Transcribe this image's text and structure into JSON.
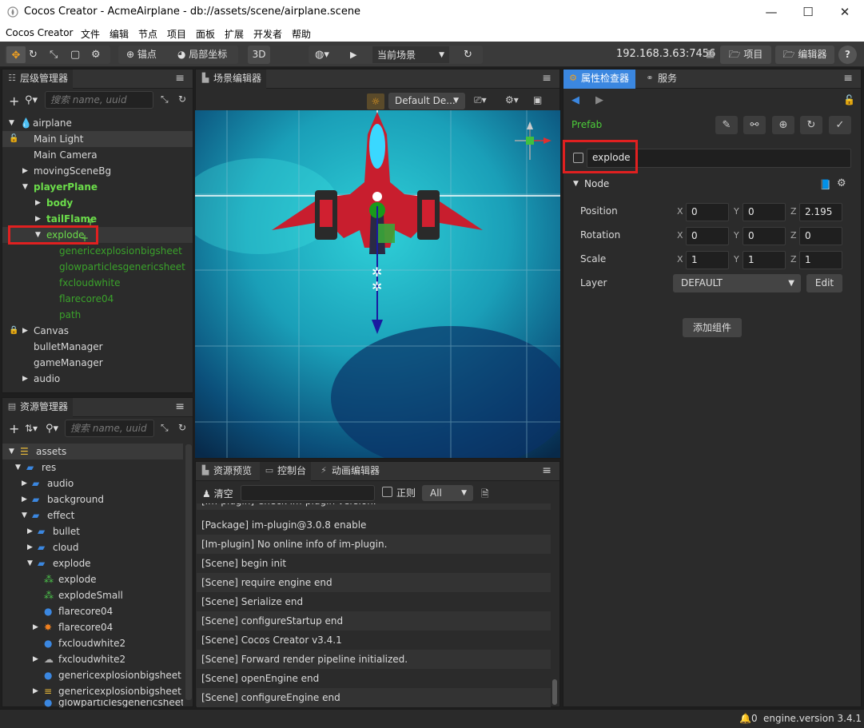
{
  "window": {
    "title": "Cocos Creator - AcmeAirplane - db://assets/scene/airplane.scene"
  },
  "menu": [
    "Cocos Creator",
    "文件",
    "编辑",
    "节点",
    "项目",
    "面板",
    "扩展",
    "开发者",
    "帮助"
  ],
  "toolbar": {
    "anchor_label": "锚点",
    "local_label": "局部坐标",
    "mode_3d": "3D",
    "scene_select": "当前场景",
    "ip": "192.168.3.63:7456",
    "project_btn": "项目",
    "editor_btn": "编辑器",
    "help": "?"
  },
  "hierarchy": {
    "tab": "层级管理器",
    "search_placeholder": "搜索 name, uuid",
    "items": [
      {
        "label": "airplane"
      },
      {
        "label": "Main Light"
      },
      {
        "label": "Main Camera"
      },
      {
        "label": "movingSceneBg"
      },
      {
        "label": "playerPlane"
      },
      {
        "label": "body"
      },
      {
        "label": "tailFlame"
      },
      {
        "label": "explode"
      },
      {
        "label": "genericexplosionbigsheet"
      },
      {
        "label": "glowparticlesgenericsheet"
      },
      {
        "label": "fxcloudwhite"
      },
      {
        "label": "flarecore04"
      },
      {
        "label": "path"
      },
      {
        "label": "Canvas"
      },
      {
        "label": "bulletManager"
      },
      {
        "label": "gameManager"
      },
      {
        "label": "audio"
      }
    ]
  },
  "assets": {
    "tab": "资源管理器",
    "search_placeholder": "搜索 name, uuid",
    "items": [
      {
        "label": "assets"
      },
      {
        "label": "res"
      },
      {
        "label": "audio"
      },
      {
        "label": "background"
      },
      {
        "label": "effect"
      },
      {
        "label": "bullet"
      },
      {
        "label": "cloud"
      },
      {
        "label": "explode"
      },
      {
        "label": "explode"
      },
      {
        "label": "explodeSmall"
      },
      {
        "label": "flarecore04"
      },
      {
        "label": "flarecore04"
      },
      {
        "label": "fxcloudwhite2"
      },
      {
        "label": "fxcloudwhite2"
      },
      {
        "label": "genericexplosionbigsheet"
      },
      {
        "label": "genericexplosionbigsheet"
      },
      {
        "label": "glowparticlesgenericsheet"
      }
    ]
  },
  "scene_editor": {
    "tab": "场景编辑器",
    "camera_select": "Default De..."
  },
  "bottom": {
    "tabs": [
      "资源预览",
      "控制台",
      "动画编辑器"
    ],
    "clear_label": "清空",
    "regex_label": "正则",
    "level_select": "All",
    "logs": [
      "[Im-plugin] Check im-plugin version.",
      "[Package] im-plugin@3.0.8 enable",
      "[Im-plugin] No online info of im-plugin.",
      "[Scene] begin init",
      "[Scene] require engine end",
      "[Scene] Serialize end",
      "[Scene] configureStartup end",
      "[Scene] Cocos Creator v3.4.1",
      "[Scene] Forward render pipeline initialized.",
      "[Scene] openEngine end",
      "[Scene] configureEngine end"
    ]
  },
  "inspector": {
    "tab": "属性检查器",
    "tab2": "服务",
    "prefab_label": "Prefab",
    "node_name": "explode",
    "section": "Node",
    "position_label": "Position",
    "rotation_label": "Rotation",
    "scale_label": "Scale",
    "layer_label": "Layer",
    "position": {
      "x": "0",
      "y": "0",
      "z": "2.195"
    },
    "rotation": {
      "x": "0",
      "y": "0",
      "z": "0"
    },
    "scale": {
      "x": "1",
      "y": "1",
      "z": "1"
    },
    "layer": "DEFAULT",
    "edit_btn": "Edit",
    "add_component": "添加组件",
    "axis": {
      "x": "X",
      "y": "Y",
      "z": "Z"
    }
  },
  "status": {
    "count": "0",
    "engine": "engine.version 3.4.1"
  },
  "colors": {
    "accent": "#3b87e0",
    "highlight": "#e02020",
    "green": "#6bdc4a"
  }
}
